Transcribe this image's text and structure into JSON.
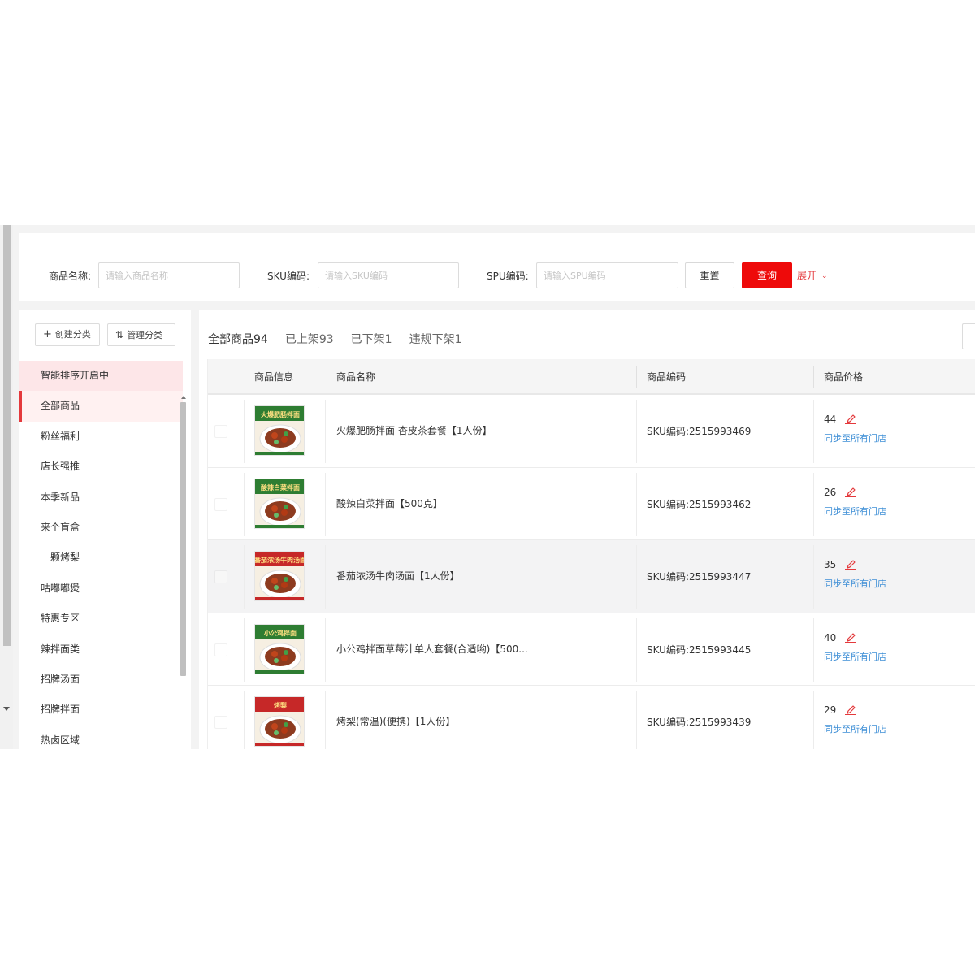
{
  "filters": {
    "name_label": "商品名称:",
    "name_placeholder": "请输入商品名称",
    "sku_label": "SKU编码:",
    "sku_placeholder": "请输入SKU编码",
    "spu_label": "SPU编码:",
    "spu_placeholder": "请输入SPU编码",
    "reset_label": "重置",
    "query_label": "查询",
    "expand_label": "展开"
  },
  "categories": {
    "create_label": "创建分类",
    "manage_label": "管理分类",
    "items": [
      "智能排序开启中",
      "全部商品",
      "粉丝福利",
      "店长强推",
      "本季新品",
      "来个盲盒",
      "一颗烤梨",
      "咕嘟嘟煲",
      "特惠专区",
      "辣拌面类",
      "招牌汤面",
      "招牌拌面",
      "热卤区域"
    ],
    "active_index": 1
  },
  "tabs": [
    {
      "label": "全部商品94"
    },
    {
      "label": "已上架93"
    },
    {
      "label": "已下架1"
    },
    {
      "label": "违规下架1"
    }
  ],
  "table": {
    "headers": [
      "商品信息",
      "商品名称",
      "商品编码",
      "商品价格"
    ],
    "sync_label": "同步至所有门店",
    "rows": [
      {
        "name": "火爆肥肠拌面 杏皮茶套餐【1人份】",
        "sku": "SKU编码:2515993469",
        "price": "44",
        "thumb_text": "火爆肥肠拌面",
        "thumb_color": "#2e7d32"
      },
      {
        "name": "酸辣白菜拌面【500克】",
        "sku": "SKU编码:2515993462",
        "price": "26",
        "thumb_text": "酸辣白菜拌面",
        "thumb_color": "#2e7d32"
      },
      {
        "name": "番茄浓汤牛肉汤面【1人份】",
        "sku": "SKU编码:2515993447",
        "price": "35",
        "thumb_text": "番茄浓汤牛肉汤面",
        "thumb_color": "#c62828"
      },
      {
        "name": "小公鸡拌面草莓汁单人套餐(合适哟)【500...",
        "sku": "SKU编码:2515993445",
        "price": "40",
        "thumb_text": "小公鸡拌面",
        "thumb_color": "#2e7d32"
      },
      {
        "name": "烤梨(常温)(便携)【1人份】",
        "sku": "SKU编码:2515993439",
        "price": "29",
        "thumb_text": "烤梨",
        "thumb_color": "#c62828"
      }
    ]
  },
  "colors": {
    "accent": "#ee0a0a",
    "link": "#3f8fd6",
    "active_bg": "#fff1f1"
  }
}
